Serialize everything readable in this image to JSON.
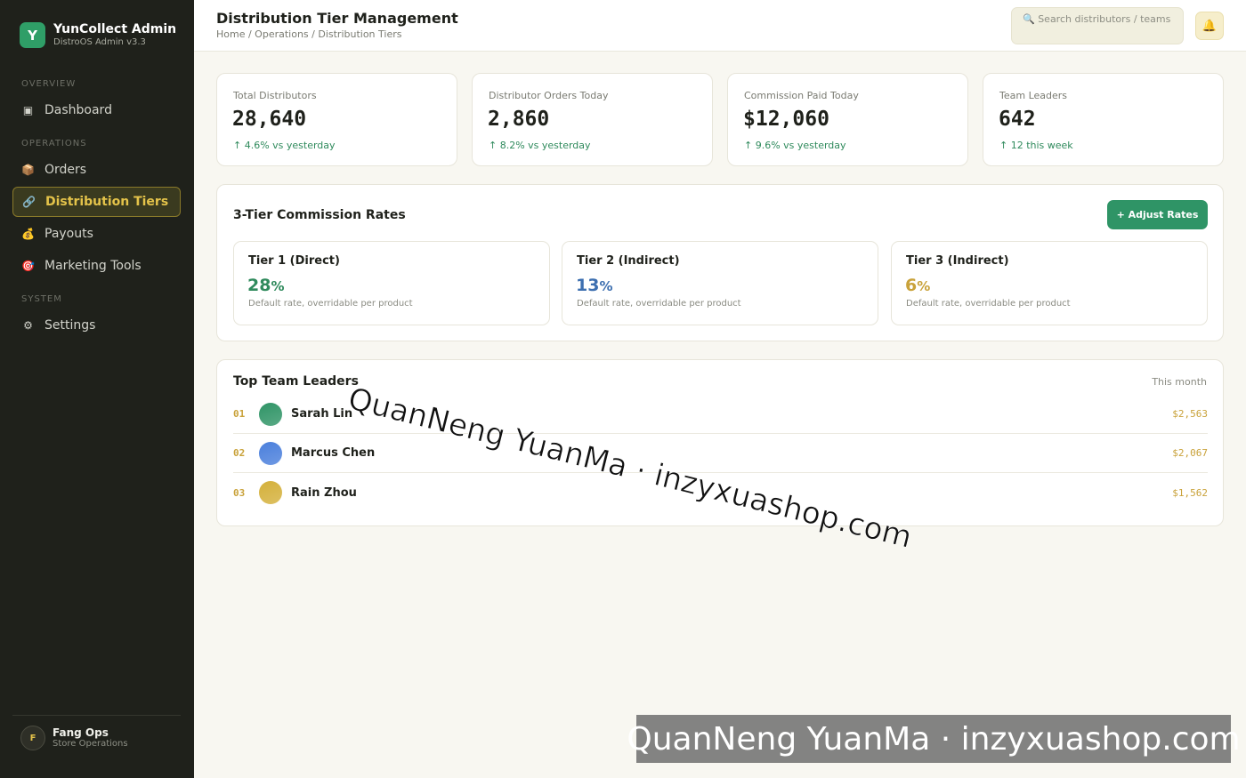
{
  "brand": {
    "logo_letter": "Y",
    "name": "YunCollect Admin",
    "subtitle": "DistroOS Admin v3.3"
  },
  "sidebar": {
    "sections": [
      "OVERVIEW",
      "OPERATIONS",
      "SYSTEM"
    ],
    "items": [
      {
        "label": "Dashboard",
        "icon": "▣",
        "icon_name": "dashboard-icon"
      },
      {
        "label": "Orders",
        "icon": "📦",
        "icon_name": "package-icon"
      },
      {
        "label": "Distribution Tiers",
        "icon": "🔗",
        "icon_name": "link-icon",
        "active": true
      },
      {
        "label": "Payouts",
        "icon": "💰",
        "icon_name": "money-bag-icon"
      },
      {
        "label": "Marketing Tools",
        "icon": "🎯",
        "icon_name": "target-icon"
      },
      {
        "label": "Settings",
        "icon": "⚙",
        "icon_name": "gear-icon"
      }
    ],
    "user": {
      "initial": "F",
      "name": "Fang Ops",
      "role": "Store Operations"
    }
  },
  "header": {
    "title": "Distribution Tier Management",
    "breadcrumb": "Home / Operations / Distribution Tiers",
    "search_placeholder": "🔍 Search distributors / teams",
    "bell_icon": "🔔"
  },
  "stats": [
    {
      "label": "Total Distributors",
      "value": "28,640",
      "delta": "↑ 4.6% vs yesterday"
    },
    {
      "label": "Distributor Orders Today",
      "value": "2,860",
      "delta": "↑ 8.2% vs yesterday"
    },
    {
      "label": "Commission Paid Today",
      "value": "$12,060",
      "delta": "↑ 9.6% vs yesterday"
    },
    {
      "label": "Team Leaders",
      "value": "642",
      "delta": "↑ 12 this week"
    }
  ],
  "commission": {
    "title": "3-Tier Commission Rates",
    "button_label": "+ Adjust Rates",
    "tiers": [
      {
        "name": "Tier 1 (Direct)",
        "rate": "28",
        "unit": "%",
        "color": "#2f8a5c",
        "desc": "Default rate, overridable per product"
      },
      {
        "name": "Tier 2 (Indirect)",
        "rate": "13",
        "unit": "%",
        "color": "#3d6fb0",
        "desc": "Default rate, overridable per product"
      },
      {
        "name": "Tier 3 (Indirect)",
        "rate": "6",
        "unit": "%",
        "color": "#c9a23a",
        "desc": "Default rate, overridable per product"
      }
    ]
  },
  "leaders": {
    "title": "Top Team Leaders",
    "period": "This month",
    "rows": [
      {
        "rank": "01",
        "name": "Sarah Lin",
        "amount": "$2,563",
        "avatar_color": "#2f9466"
      },
      {
        "rank": "02",
        "name": "Marcus Chen",
        "amount": "$2,067",
        "avatar_color": "#4a7fdc"
      },
      {
        "rank": "03",
        "name": "Rain Zhou",
        "amount": "$1,562",
        "avatar_color": "#d4b03a"
      }
    ]
  },
  "watermark": {
    "text": "QuanNeng YuanMa · inzyxuashop.com"
  }
}
